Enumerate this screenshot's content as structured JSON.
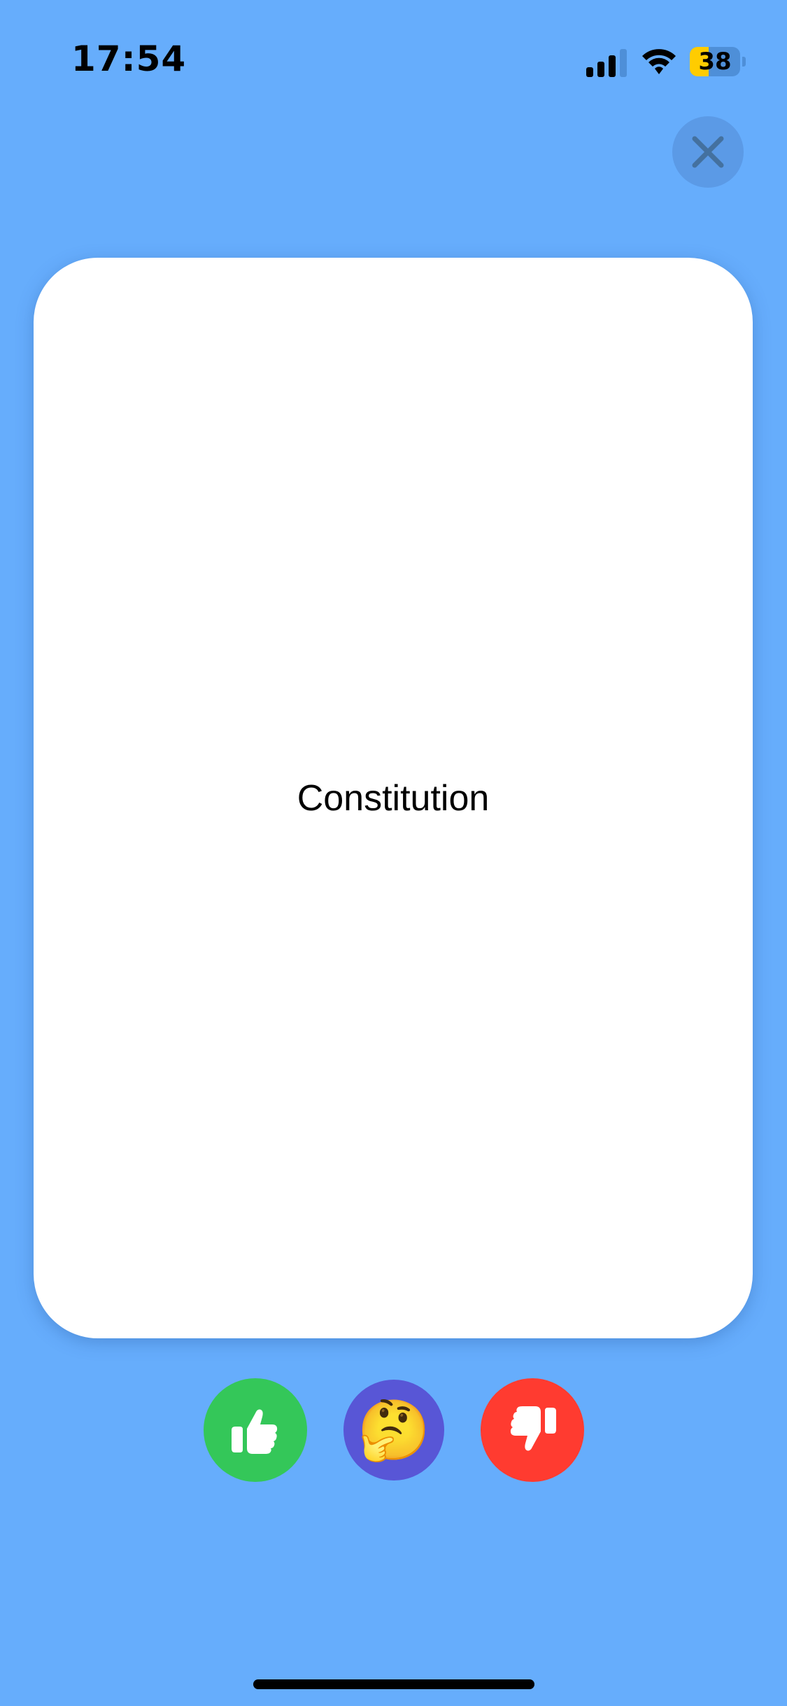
{
  "status_bar": {
    "time": "17:54",
    "battery_level": "38",
    "battery_fraction": 0.38,
    "icons": [
      "cellular-signal-icon",
      "wifi-icon",
      "battery-icon"
    ]
  },
  "colors": {
    "background": "#66adfc",
    "card": "#ffffff",
    "like": "#34c759",
    "unsure": "#5856d6",
    "dislike": "#ff3b30",
    "close_button": "#5b9ae6",
    "close_icon": "#44719f"
  },
  "close_button": {
    "icon": "close-icon"
  },
  "card": {
    "word": "Constitution"
  },
  "actions": [
    {
      "id": "like",
      "icon": "thumbs-up-icon",
      "color": "#34c759"
    },
    {
      "id": "unsure",
      "icon": "thinking-face-icon",
      "glyph": "🤔",
      "color": "#5856d6"
    },
    {
      "id": "dislike",
      "icon": "thumbs-down-icon",
      "color": "#ff3b30"
    }
  ]
}
